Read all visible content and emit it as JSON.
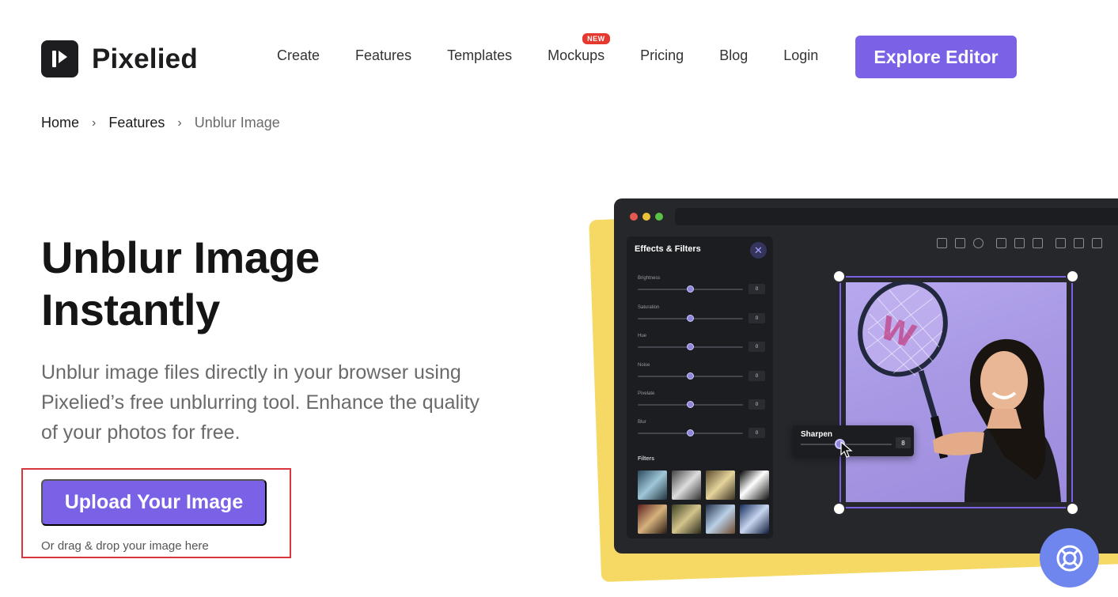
{
  "brand": {
    "name": "Pixelied",
    "accent": "#7b61e6"
  },
  "nav": {
    "items": [
      "Create",
      "Features",
      "Templates",
      "Mockups",
      "Pricing",
      "Blog",
      "Login"
    ],
    "new_badge": "NEW",
    "cta": "Explore Editor"
  },
  "breadcrumb": {
    "home": "Home",
    "features": "Features",
    "current": "Unblur Image"
  },
  "hero": {
    "title_line1": "Unblur Image",
    "title_line2": "Instantly",
    "description": "Unblur image files directly in your browser using Pixelied’s free unblurring tool. Enhance the quality of your photos for free.",
    "upload_button": "Upload Your Image",
    "upload_hint": "Or drag & drop your image here"
  },
  "editor": {
    "panel_title": "Effects & Filters",
    "sliders": [
      {
        "label": "Brightness",
        "value": "0"
      },
      {
        "label": "Saturation",
        "value": "0"
      },
      {
        "label": "Hue",
        "value": "0"
      },
      {
        "label": "Noise",
        "value": "0"
      },
      {
        "label": "Pixelate",
        "value": "0"
      },
      {
        "label": "Blur",
        "value": "0"
      }
    ],
    "filters_label": "Filters",
    "sharpen": {
      "label": "Sharpen",
      "value": "8"
    }
  }
}
